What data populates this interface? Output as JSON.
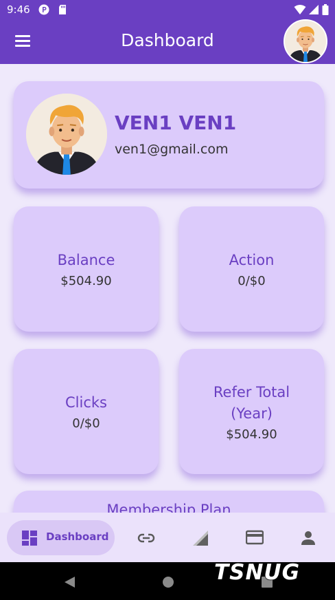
{
  "status_bar": {
    "time": "9:46",
    "icons": [
      "circle-p-icon",
      "sd-card-icon",
      "wifi-icon",
      "cell-signal-icon",
      "battery-icon"
    ]
  },
  "app_bar": {
    "title": "Dashboard",
    "menu_icon": "hamburger-menu-icon",
    "avatar_icon": "user-avatar-icon"
  },
  "profile": {
    "name": "VEN1 VEN1",
    "email": "ven1@gmail.com"
  },
  "stats": [
    {
      "label": "Balance",
      "value": "$504.90"
    },
    {
      "label": "Action",
      "value": "0/$0"
    },
    {
      "label": "Clicks",
      "value": "0/$0"
    },
    {
      "label": "Refer Total (Year)",
      "value": "$504.90"
    }
  ],
  "membership": {
    "label": "Membership Plan"
  },
  "bottom_nav": {
    "items": [
      {
        "label": "Dashboard",
        "icon": "dashboard-grid-icon",
        "active": true
      },
      {
        "label": "",
        "icon": "link-icon"
      },
      {
        "label": "",
        "icon": "signal-triangle-icon"
      },
      {
        "label": "",
        "icon": "credit-card-icon"
      },
      {
        "label": "",
        "icon": "person-icon"
      }
    ]
  },
  "system_nav": {
    "buttons": [
      "back-icon",
      "home-icon",
      "recents-icon"
    ]
  },
  "watermark": "TSNUG",
  "colors": {
    "primary": "#6a3fc2",
    "card": "#dccbfb",
    "background": "#efe9fb",
    "nav_background": "#ebe2fb"
  }
}
